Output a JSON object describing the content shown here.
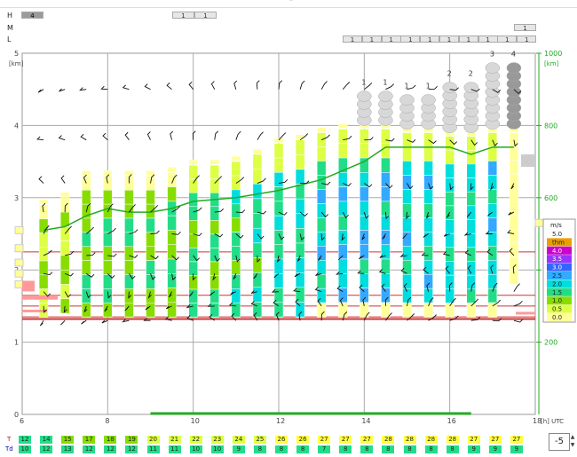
{
  "ui": {
    "h_label": "H",
    "m_label": "M",
    "l_label": "L",
    "h_boxes": [
      "4",
      "1",
      "1"
    ],
    "m_boxes": [
      "1"
    ],
    "l_boxes": [
      "1",
      "1",
      "1",
      "1",
      "1",
      "1",
      "1",
      "1",
      "1",
      "1"
    ],
    "stepper_value": "-5",
    "t_label": "T",
    "td_label": "Td"
  },
  "chart_data": {
    "type": "heatmap",
    "x_ticks": [
      6,
      8,
      10,
      12,
      14,
      16,
      18
    ],
    "x_unit_label": "[h] UTC",
    "left_axis": {
      "unit": "[km]",
      "ticks": [
        0,
        1,
        2,
        3,
        4,
        5
      ],
      "range": [
        0,
        5
      ]
    },
    "right_axis": {
      "unit": "[km]",
      "ticks": [
        200,
        400,
        600,
        800,
        1000
      ],
      "range": [
        0,
        1000
      ]
    },
    "legend": {
      "title": "m/s",
      "items": [
        {
          "label": "5.0",
          "color": "#ffffff"
        },
        {
          "label": "thm",
          "color": "#e8a000"
        },
        {
          "label": "4.0",
          "color": "#cc00cc"
        },
        {
          "label": "3.5",
          "color": "#9933ff"
        },
        {
          "label": "3.0",
          "color": "#3366ff"
        },
        {
          "label": "2.5",
          "color": "#33aaff"
        },
        {
          "label": "2.0",
          "color": "#00dddd"
        },
        {
          "label": "1.5",
          "color": "#22dd88"
        },
        {
          "label": "1.0",
          "color": "#88dd00"
        },
        {
          "label": "0.5",
          "color": "#ddff44"
        },
        {
          "label": "0.0",
          "color": "#ffff99"
        }
      ]
    },
    "columns": [
      {
        "x": 6.5,
        "top": 2.9,
        "base": 1.35,
        "t": "12",
        "td": "10",
        "cloud": ""
      },
      {
        "x": 7.0,
        "top": 3.0,
        "base": 1.4,
        "t": "14",
        "td": "12",
        "cloud": ""
      },
      {
        "x": 7.5,
        "top": 3.3,
        "base": 1.35,
        "t": "15",
        "td": "13",
        "cloud": ""
      },
      {
        "x": 8.0,
        "top": 3.3,
        "base": 1.35,
        "t": "17",
        "td": "12",
        "cloud": ""
      },
      {
        "x": 8.5,
        "top": 3.3,
        "base": 1.35,
        "t": "18",
        "td": "12",
        "cloud": ""
      },
      {
        "x": 9.0,
        "top": 3.3,
        "base": 1.35,
        "t": "19",
        "td": "12",
        "cloud": ""
      },
      {
        "x": 9.5,
        "top": 3.35,
        "base": 1.35,
        "t": "20",
        "td": "11",
        "cloud": ""
      },
      {
        "x": 10.0,
        "top": 3.45,
        "base": 1.35,
        "t": "21",
        "td": "11",
        "cloud": ""
      },
      {
        "x": 10.5,
        "top": 3.45,
        "base": 1.35,
        "t": "22",
        "td": "10",
        "cloud": ""
      },
      {
        "x": 11.0,
        "top": 3.5,
        "base": 1.35,
        "t": "23",
        "td": "10",
        "cloud": ""
      },
      {
        "x": 11.5,
        "top": 3.6,
        "base": 1.35,
        "t": "24",
        "td": "9",
        "cloud": ""
      },
      {
        "x": 12.0,
        "top": 3.75,
        "base": 1.35,
        "t": "25",
        "td": "8",
        "cloud": ""
      },
      {
        "x": 12.5,
        "top": 3.8,
        "base": 1.35,
        "t": "26",
        "td": "8",
        "cloud": ""
      },
      {
        "x": 13.0,
        "top": 3.9,
        "base": 1.35,
        "t": "26",
        "td": "8",
        "cloud": ""
      },
      {
        "x": 13.5,
        "top": 3.95,
        "base": 1.35,
        "t": "27",
        "td": "7",
        "cloud": ""
      },
      {
        "x": 14.0,
        "top": 3.95,
        "base": 1.35,
        "t": "27",
        "td": "8",
        "cloud": "1"
      },
      {
        "x": 14.5,
        "top": 3.95,
        "base": 1.35,
        "t": "27",
        "td": "8",
        "cloud": "1"
      },
      {
        "x": 15.0,
        "top": 3.9,
        "base": 1.35,
        "t": "28",
        "td": "8",
        "cloud": "1"
      },
      {
        "x": 15.5,
        "top": 3.9,
        "base": 1.35,
        "t": "28",
        "td": "8",
        "cloud": "1"
      },
      {
        "x": 16.0,
        "top": 3.85,
        "base": 1.35,
        "t": "28",
        "td": "8",
        "cloud": "2"
      },
      {
        "x": 16.5,
        "top": 3.85,
        "base": 1.35,
        "t": "28",
        "td": "8",
        "cloud": "2"
      },
      {
        "x": 17.0,
        "top": 3.9,
        "base": 1.35,
        "t": "27",
        "td": "9",
        "cloud": "3"
      },
      {
        "x": 17.5,
        "top": 3.9,
        "base": 1.8,
        "t": "27",
        "td": "9",
        "cloud": "4"
      }
    ],
    "extra_footer": [
      {
        "t": "27",
        "td": "9"
      }
    ],
    "wind_levels": [
      4.5,
      3.8,
      3.2,
      2.8,
      2.5,
      2.2,
      1.95,
      1.7,
      1.5,
      1.3
    ]
  }
}
